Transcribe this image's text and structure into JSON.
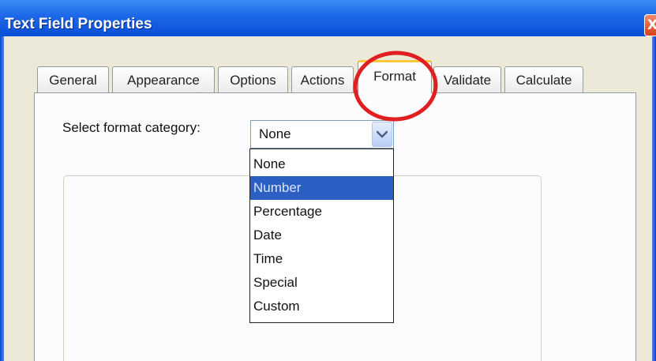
{
  "window": {
    "title": "Text Field Properties",
    "close_glyph": "X"
  },
  "tabs": [
    {
      "label": "General"
    },
    {
      "label": "Appearance"
    },
    {
      "label": "Options"
    },
    {
      "label": "Actions"
    },
    {
      "label": "Format",
      "active": true
    },
    {
      "label": "Validate"
    },
    {
      "label": "Calculate"
    }
  ],
  "format": {
    "category_label": "Select format category:",
    "selected_value": "None",
    "options": [
      "None",
      "Number",
      "Percentage",
      "Date",
      "Time",
      "Special",
      "Custom"
    ],
    "highlighted_option": "Number"
  },
  "annotation": {
    "type": "red-ellipse-highlight",
    "target": "Format tab",
    "color": "#e02020"
  },
  "colors": {
    "titlebar": "#0a4fd8",
    "active_tab_accent": "#ffc83c",
    "selection": "#2c5fc4"
  },
  "icons": {
    "close": "close-icon",
    "dropdown": "chevron-down-icon"
  }
}
